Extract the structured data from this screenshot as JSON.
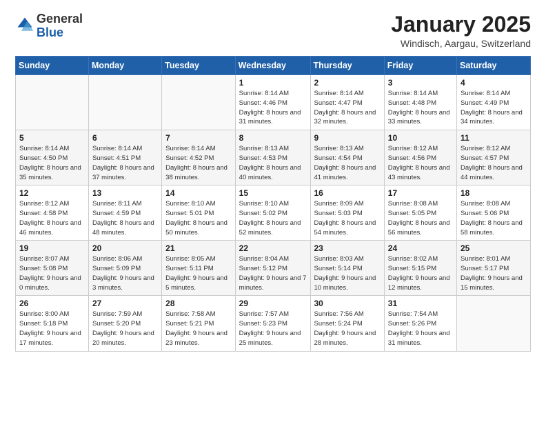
{
  "header": {
    "logo_general": "General",
    "logo_blue": "Blue",
    "month_title": "January 2025",
    "location": "Windisch, Aargau, Switzerland"
  },
  "weekdays": [
    "Sunday",
    "Monday",
    "Tuesday",
    "Wednesday",
    "Thursday",
    "Friday",
    "Saturday"
  ],
  "weeks": [
    [
      {
        "day": "",
        "sunrise": "",
        "sunset": "",
        "daylight": ""
      },
      {
        "day": "",
        "sunrise": "",
        "sunset": "",
        "daylight": ""
      },
      {
        "day": "",
        "sunrise": "",
        "sunset": "",
        "daylight": ""
      },
      {
        "day": "1",
        "sunrise": "Sunrise: 8:14 AM",
        "sunset": "Sunset: 4:46 PM",
        "daylight": "Daylight: 8 hours and 31 minutes."
      },
      {
        "day": "2",
        "sunrise": "Sunrise: 8:14 AM",
        "sunset": "Sunset: 4:47 PM",
        "daylight": "Daylight: 8 hours and 32 minutes."
      },
      {
        "day": "3",
        "sunrise": "Sunrise: 8:14 AM",
        "sunset": "Sunset: 4:48 PM",
        "daylight": "Daylight: 8 hours and 33 minutes."
      },
      {
        "day": "4",
        "sunrise": "Sunrise: 8:14 AM",
        "sunset": "Sunset: 4:49 PM",
        "daylight": "Daylight: 8 hours and 34 minutes."
      }
    ],
    [
      {
        "day": "5",
        "sunrise": "Sunrise: 8:14 AM",
        "sunset": "Sunset: 4:50 PM",
        "daylight": "Daylight: 8 hours and 35 minutes."
      },
      {
        "day": "6",
        "sunrise": "Sunrise: 8:14 AM",
        "sunset": "Sunset: 4:51 PM",
        "daylight": "Daylight: 8 hours and 37 minutes."
      },
      {
        "day": "7",
        "sunrise": "Sunrise: 8:14 AM",
        "sunset": "Sunset: 4:52 PM",
        "daylight": "Daylight: 8 hours and 38 minutes."
      },
      {
        "day": "8",
        "sunrise": "Sunrise: 8:13 AM",
        "sunset": "Sunset: 4:53 PM",
        "daylight": "Daylight: 8 hours and 40 minutes."
      },
      {
        "day": "9",
        "sunrise": "Sunrise: 8:13 AM",
        "sunset": "Sunset: 4:54 PM",
        "daylight": "Daylight: 8 hours and 41 minutes."
      },
      {
        "day": "10",
        "sunrise": "Sunrise: 8:12 AM",
        "sunset": "Sunset: 4:56 PM",
        "daylight": "Daylight: 8 hours and 43 minutes."
      },
      {
        "day": "11",
        "sunrise": "Sunrise: 8:12 AM",
        "sunset": "Sunset: 4:57 PM",
        "daylight": "Daylight: 8 hours and 44 minutes."
      }
    ],
    [
      {
        "day": "12",
        "sunrise": "Sunrise: 8:12 AM",
        "sunset": "Sunset: 4:58 PM",
        "daylight": "Daylight: 8 hours and 46 minutes."
      },
      {
        "day": "13",
        "sunrise": "Sunrise: 8:11 AM",
        "sunset": "Sunset: 4:59 PM",
        "daylight": "Daylight: 8 hours and 48 minutes."
      },
      {
        "day": "14",
        "sunrise": "Sunrise: 8:10 AM",
        "sunset": "Sunset: 5:01 PM",
        "daylight": "Daylight: 8 hours and 50 minutes."
      },
      {
        "day": "15",
        "sunrise": "Sunrise: 8:10 AM",
        "sunset": "Sunset: 5:02 PM",
        "daylight": "Daylight: 8 hours and 52 minutes."
      },
      {
        "day": "16",
        "sunrise": "Sunrise: 8:09 AM",
        "sunset": "Sunset: 5:03 PM",
        "daylight": "Daylight: 8 hours and 54 minutes."
      },
      {
        "day": "17",
        "sunrise": "Sunrise: 8:08 AM",
        "sunset": "Sunset: 5:05 PM",
        "daylight": "Daylight: 8 hours and 56 minutes."
      },
      {
        "day": "18",
        "sunrise": "Sunrise: 8:08 AM",
        "sunset": "Sunset: 5:06 PM",
        "daylight": "Daylight: 8 hours and 58 minutes."
      }
    ],
    [
      {
        "day": "19",
        "sunrise": "Sunrise: 8:07 AM",
        "sunset": "Sunset: 5:08 PM",
        "daylight": "Daylight: 9 hours and 0 minutes."
      },
      {
        "day": "20",
        "sunrise": "Sunrise: 8:06 AM",
        "sunset": "Sunset: 5:09 PM",
        "daylight": "Daylight: 9 hours and 3 minutes."
      },
      {
        "day": "21",
        "sunrise": "Sunrise: 8:05 AM",
        "sunset": "Sunset: 5:11 PM",
        "daylight": "Daylight: 9 hours and 5 minutes."
      },
      {
        "day": "22",
        "sunrise": "Sunrise: 8:04 AM",
        "sunset": "Sunset: 5:12 PM",
        "daylight": "Daylight: 9 hours and 7 minutes."
      },
      {
        "day": "23",
        "sunrise": "Sunrise: 8:03 AM",
        "sunset": "Sunset: 5:14 PM",
        "daylight": "Daylight: 9 hours and 10 minutes."
      },
      {
        "day": "24",
        "sunrise": "Sunrise: 8:02 AM",
        "sunset": "Sunset: 5:15 PM",
        "daylight": "Daylight: 9 hours and 12 minutes."
      },
      {
        "day": "25",
        "sunrise": "Sunrise: 8:01 AM",
        "sunset": "Sunset: 5:17 PM",
        "daylight": "Daylight: 9 hours and 15 minutes."
      }
    ],
    [
      {
        "day": "26",
        "sunrise": "Sunrise: 8:00 AM",
        "sunset": "Sunset: 5:18 PM",
        "daylight": "Daylight: 9 hours and 17 minutes."
      },
      {
        "day": "27",
        "sunrise": "Sunrise: 7:59 AM",
        "sunset": "Sunset: 5:20 PM",
        "daylight": "Daylight: 9 hours and 20 minutes."
      },
      {
        "day": "28",
        "sunrise": "Sunrise: 7:58 AM",
        "sunset": "Sunset: 5:21 PM",
        "daylight": "Daylight: 9 hours and 23 minutes."
      },
      {
        "day": "29",
        "sunrise": "Sunrise: 7:57 AM",
        "sunset": "Sunset: 5:23 PM",
        "daylight": "Daylight: 9 hours and 25 minutes."
      },
      {
        "day": "30",
        "sunrise": "Sunrise: 7:56 AM",
        "sunset": "Sunset: 5:24 PM",
        "daylight": "Daylight: 9 hours and 28 minutes."
      },
      {
        "day": "31",
        "sunrise": "Sunrise: 7:54 AM",
        "sunset": "Sunset: 5:26 PM",
        "daylight": "Daylight: 9 hours and 31 minutes."
      },
      {
        "day": "",
        "sunrise": "",
        "sunset": "",
        "daylight": ""
      }
    ]
  ]
}
